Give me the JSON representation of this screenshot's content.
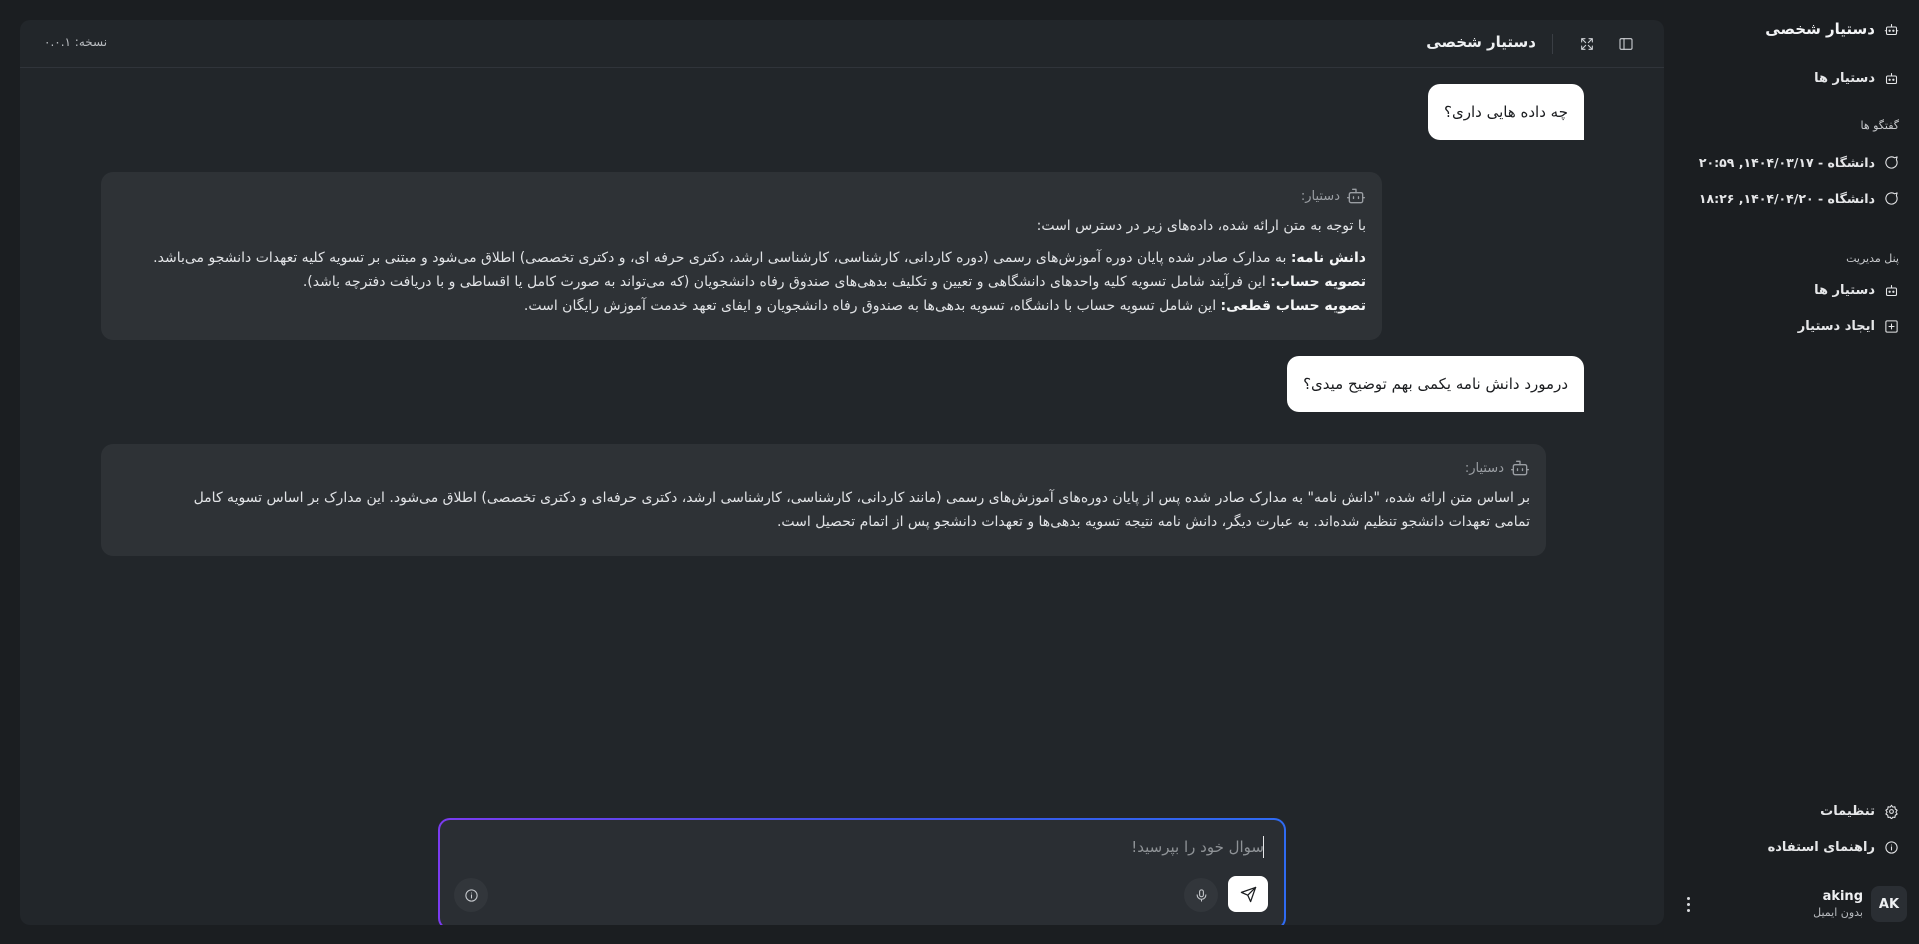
{
  "sidebar": {
    "app_title": "دستیار شخصی",
    "assistants_label": "دستیار ها",
    "conversations_section": "گفتگو ها",
    "conversations": [
      {
        "label": "دانشگاه - ۱۴۰۴/۰۳/۱۷, ۲۰:۵۹"
      },
      {
        "label": "دانشگاه - ۱۴۰۴/۰۴/۲۰, ۱۸:۲۶"
      }
    ],
    "admin_section": "پنل مدیریت",
    "admin_items": [
      {
        "label": "دستیار ها",
        "icon": "bot-icon"
      },
      {
        "label": "ایجاد دستیار",
        "icon": "plus-square-icon"
      }
    ],
    "settings_label": "تنظیمات",
    "help_label": "راهنمای استفاده",
    "user": {
      "initials": "AK",
      "name": "aking",
      "email": "بدون ایمیل"
    }
  },
  "header": {
    "title": "دستیار شخصی",
    "version": "نسخه: ۰.۰.۱"
  },
  "chat": {
    "bot_label": "دستیار:",
    "messages": [
      {
        "role": "user",
        "text": "چه داده هایی داری؟"
      },
      {
        "role": "assistant",
        "intro": "با توجه به متن ارائه شده، داده‌های زیر در دسترس است:",
        "items": [
          {
            "term": "دانش نامه:",
            "text": " به مدارک صادر شده پایان دوره آموزش‌های رسمی (دوره کاردانی، کارشناسی، کارشناسی ارشد، دکتری حرفه ای، و دکتری تخصصی) اطلاق می‌شود و مبتنی بر تسویه کلیه تعهدات دانشجو می‌باشد."
          },
          {
            "term": "تصویه حساب:",
            "text": " این فرآیند شامل تسویه کلیه واحدهای دانشگاهی و تعیین و تکلیف بدهی‌های صندوق رفاه دانشجویان (که می‌تواند به صورت کامل یا اقساطی و با دریافت دفترچه باشد)."
          },
          {
            "term": "تصویه حساب قطعی:",
            "text": " این شامل تسویه حساب با دانشگاه، تسویه بدهی‌ها به صندوق رفاه دانشجویان و ایفای تعهد خدمت آموزش رایگان است."
          }
        ]
      },
      {
        "role": "user",
        "text": "درمورد دانش نامه یکمی بهم توضیح میدی؟"
      },
      {
        "role": "assistant",
        "lines": [
          "بر اساس متن ارائه شده، \"دانش نامه\" به مدارک صادر شده پس از پایان دوره‌های آموزش‌های رسمی (مانند کاردانی، کارشناسی، کارشناسی ارشد، دکتری حرفه‌ای و دکتری تخصصی) اطلاق می‌شود. این مدارک بر اساس تسویه کامل",
          "تمامی تعهدات دانشجو تنظیم شده‌اند. به عبارت دیگر، دانش نامه نتیجه تسویه بدهی‌ها و تعهدات دانشجو پس از اتمام تحصیل است."
        ]
      }
    ]
  },
  "composer": {
    "placeholder": "سوال خود را بپرسید!"
  }
}
